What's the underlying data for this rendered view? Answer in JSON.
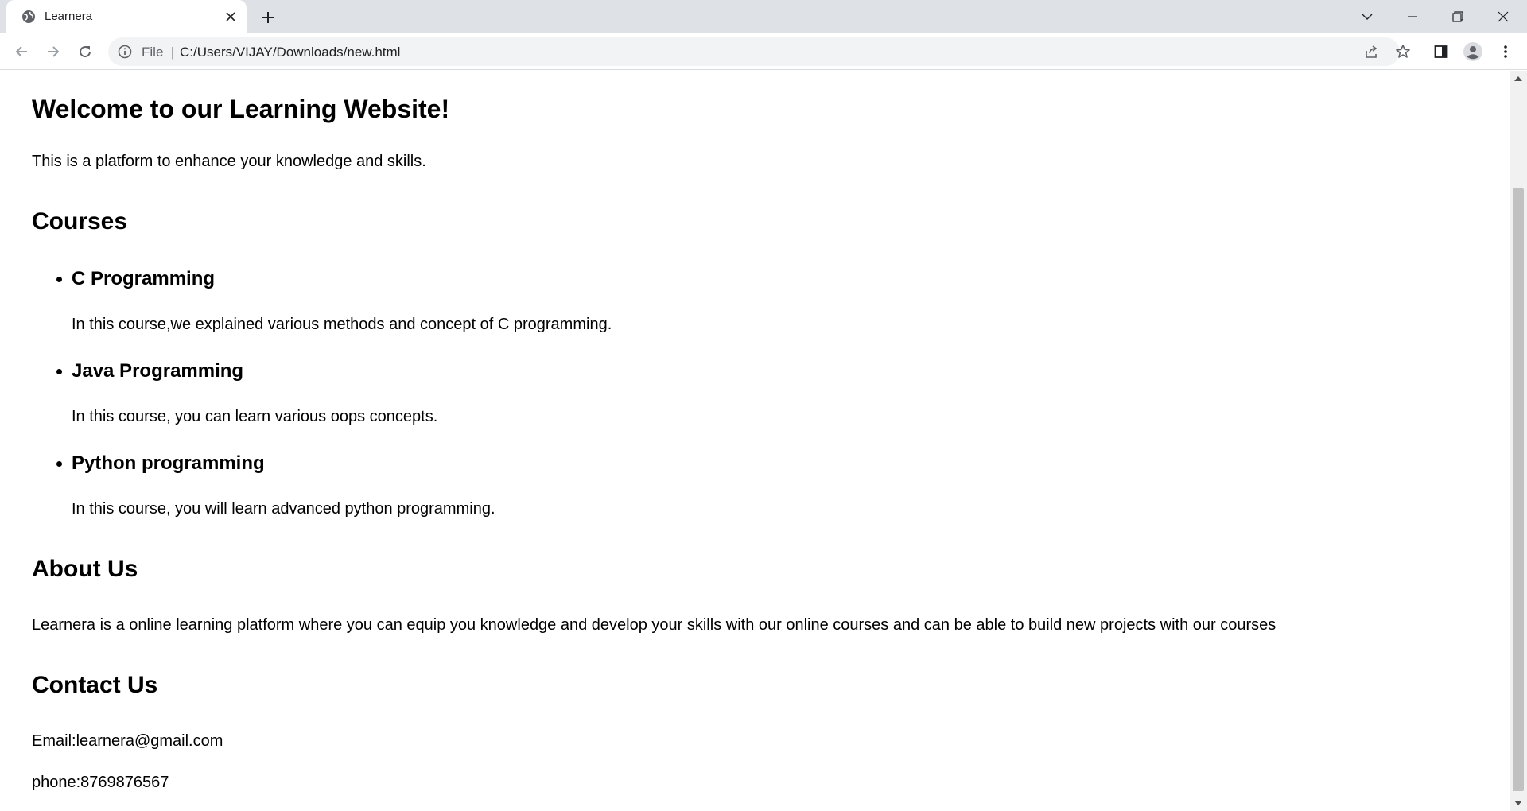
{
  "browser": {
    "tab": {
      "title": "Learnera"
    },
    "address": {
      "scheme": "File",
      "separator": "|",
      "url": "C:/Users/VIJAY/Downloads/new.html"
    },
    "icons": {
      "favicon": "globe-icon",
      "close": "close-icon",
      "new_tab": "plus-icon",
      "back": "arrow-left-icon",
      "forward": "arrow-right-icon",
      "reload": "reload-icon",
      "info": "info-icon",
      "share": "share-icon",
      "bookmark": "star-icon",
      "side_panel": "side-panel-icon",
      "profile": "profile-icon",
      "menu": "kebab-menu-icon"
    }
  },
  "page": {
    "heading": "Welcome to our Learning Website!",
    "intro": "This is a platform to enhance your knowledge and skills.",
    "courses": {
      "heading": "Courses",
      "items": [
        {
          "title": "C Programming",
          "description": "In this course,we explained various methods and concept of C programming."
        },
        {
          "title": "Java Programming",
          "description": "In this course, you can learn various oops concepts."
        },
        {
          "title": "Python programming",
          "description": "In this course, you will learn advanced python programming."
        }
      ]
    },
    "about": {
      "heading": "About Us",
      "text": "Learnera is a online learning platform where you can equip you knowledge and develop your skills with our online courses and can be able to build new projects with our courses"
    },
    "contact": {
      "heading": "Contact Us",
      "email": "Email:learnera@gmail.com",
      "phone": "phone:8769876567"
    }
  }
}
